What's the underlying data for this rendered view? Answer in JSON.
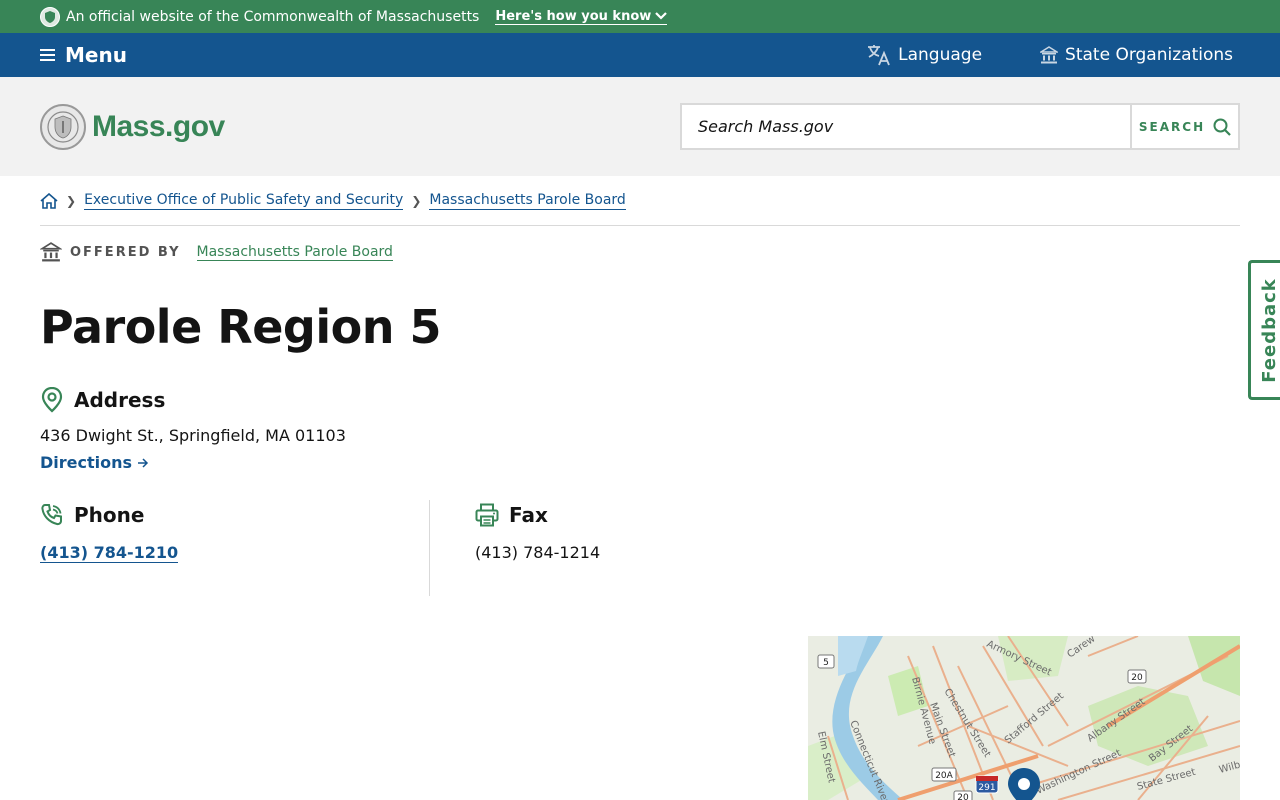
{
  "banner": {
    "text": "An official website of the Commonwealth of Massachusetts",
    "how_label": "Here's how you know"
  },
  "utility": {
    "menu_label": "Menu",
    "language_label": "Language",
    "state_orgs_label": "State Organizations"
  },
  "header": {
    "logo_text": "Mass.gov",
    "search_placeholder": "Search Mass.gov",
    "search_button": "SEARCH"
  },
  "breadcrumb": {
    "items": [
      "Executive Office of Public Safety and Security",
      "Massachusetts Parole Board"
    ]
  },
  "offered_by": {
    "label": "OFFERED BY",
    "org": "Massachusetts Parole Board"
  },
  "page_title": "Parole Region 5",
  "address": {
    "heading": "Address",
    "line": "436 Dwight St., Springfield, MA 01103",
    "directions_label": "Directions"
  },
  "phone": {
    "heading": "Phone",
    "number": "(413) 784-1210"
  },
  "fax": {
    "heading": "Fax",
    "number": "(413) 784-1214"
  },
  "feedback_label": "Feedback",
  "map": {
    "labels": [
      "Armory Street",
      "Carew",
      "Birnie Avenue",
      "Main Street",
      "Chestnut Street",
      "Stafford Street",
      "Albany Street",
      "Bay Street",
      "Elm Street",
      "Connecticut River",
      "Washington Street",
      "State Street",
      "Wilb"
    ],
    "shields": [
      "5",
      "20",
      "20A",
      "291",
      "20"
    ]
  },
  "colors": {
    "green": "#388557",
    "blue": "#14558f"
  }
}
